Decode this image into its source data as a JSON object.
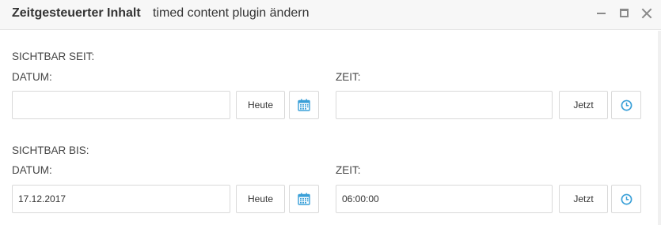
{
  "window": {
    "title": "Zeitgesteuerter Inhalt",
    "subtitle": "timed content plugin ändern"
  },
  "visible_from": {
    "section_label": "SICHTBAR SEIT:",
    "date_label": "DATUM:",
    "date_value": "",
    "today_button": "Heute",
    "time_label": "ZEIT:",
    "time_value": "",
    "now_button": "Jetzt"
  },
  "visible_until": {
    "section_label": "SICHTBAR BIS:",
    "date_label": "DATUM:",
    "date_value": "17.12.2017",
    "today_button": "Heute",
    "time_label": "ZEIT:",
    "time_value": "06:00:00",
    "now_button": "Jetzt"
  },
  "icons": {
    "calendar": "calendar-icon",
    "clock": "clock-icon",
    "accent_color": "#3aa0d8"
  }
}
